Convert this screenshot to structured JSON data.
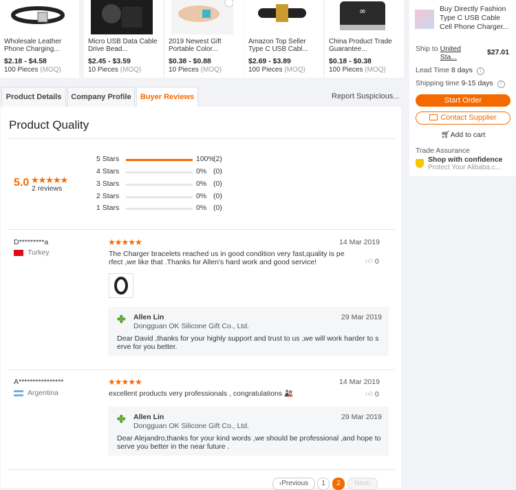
{
  "products": [
    {
      "title": "Wholesale Leather Phone Charging...",
      "price": "$2.18 - $4.58",
      "moq_qty": "100 Pieces",
      "moq_label": "(MOQ)"
    },
    {
      "title": "Micro USB Data Cable Drive Bead...",
      "price": "$2.45 - $3.59",
      "moq_qty": "10 Pieces",
      "moq_label": "(MOQ)"
    },
    {
      "title": "2019 Newest Gift Portable Color...",
      "price": "$0.38 - $0.88",
      "moq_qty": "10 Pieces",
      "moq_label": "(MOQ)"
    },
    {
      "title": "Amazon Top Seller Type C USB Cabl...",
      "price": "$2.69 - $3.89",
      "moq_qty": "100 Pieces",
      "moq_label": "(MOQ)"
    },
    {
      "title": "China Product Trade Guarantee...",
      "price": "$0.18 - $0.38",
      "moq_qty": "100 Pieces",
      "moq_label": "(MOQ)"
    }
  ],
  "sidebar": {
    "product_title": "Buy Directly Fashion Type C USB Cable Cell Phone Charger...",
    "ship_to_label": "Ship to",
    "ship_to_country": "United Sta...",
    "ship_price": "$27.01",
    "lead_time_label": "Lead Time",
    "lead_time_value": "8 days",
    "shipping_time_label": "Shipping time",
    "shipping_time_value": "9-15 days",
    "start_order": "Start Order",
    "contact_supplier": "Contact Supplier",
    "add_to_cart": "Add to cart",
    "trade_assurance": "Trade Assurance",
    "shop_confidence": "Shop with confidence",
    "protect_text": "Protect Your Alibaba.c..."
  },
  "tabs": {
    "product_details": "Product Details",
    "company_profile": "Company Profile",
    "buyer_reviews": "Buyer Reviews",
    "report": "Report Suspicious..."
  },
  "quality": {
    "heading": "Product Quality",
    "score": "5.0",
    "stars": "★★★★★",
    "reviews_count": "2 reviews",
    "breakdown": [
      {
        "label": "5 Stars",
        "fraction": 1.0,
        "pct": "100%",
        "count": "(2)"
      },
      {
        "label": "4 Stars",
        "fraction": 0,
        "pct": "0%",
        "count": "(0)"
      },
      {
        "label": "3 Stars",
        "fraction": 0,
        "pct": "0%",
        "count": "(0)"
      },
      {
        "label": "2 Stars",
        "fraction": 0,
        "pct": "0%",
        "count": "(0)"
      },
      {
        "label": "1 Stars",
        "fraction": 0,
        "pct": "0%",
        "count": "(0)"
      }
    ]
  },
  "reviews": [
    {
      "reviewer": "D*********a",
      "country": "Turkey",
      "stars": "★★★★★",
      "date": "14 Mar 2019",
      "text": "The Charger bracelets reached us in good condition very fast,quality is perfect ,we like that .Thanks for Allen's hard work and good service!",
      "likes": "0",
      "reply_name": "Allen Lin",
      "reply_company": "Dongguan OK Silicone Gift Co., Ltd.",
      "reply_date": "29 Mar 2019",
      "reply_text": "Dear David ,thanks for your highly support and trust to us ,we will work harder to serve for you better."
    },
    {
      "reviewer": "A****************",
      "country": "Argentina",
      "stars": "★★★★★",
      "date": "14 Mar 2019",
      "text": "excellent products very professionals , congratulations 🎎",
      "likes": "0",
      "reply_name": "Allen Lin",
      "reply_company": "Dongguan OK Silicone Gift Co., Ltd.",
      "reply_date": "29 Mar 2019",
      "reply_text": "Dear Alejandro,thanks for your kind words ,we should be professional ,and hope to serve you better in the near future ."
    }
  ],
  "pagination": {
    "previous": "Previous",
    "page1": "1",
    "page2": "2",
    "next": "Next"
  },
  "colors": {
    "accent": "#f56a00",
    "star": "#f56a00"
  }
}
